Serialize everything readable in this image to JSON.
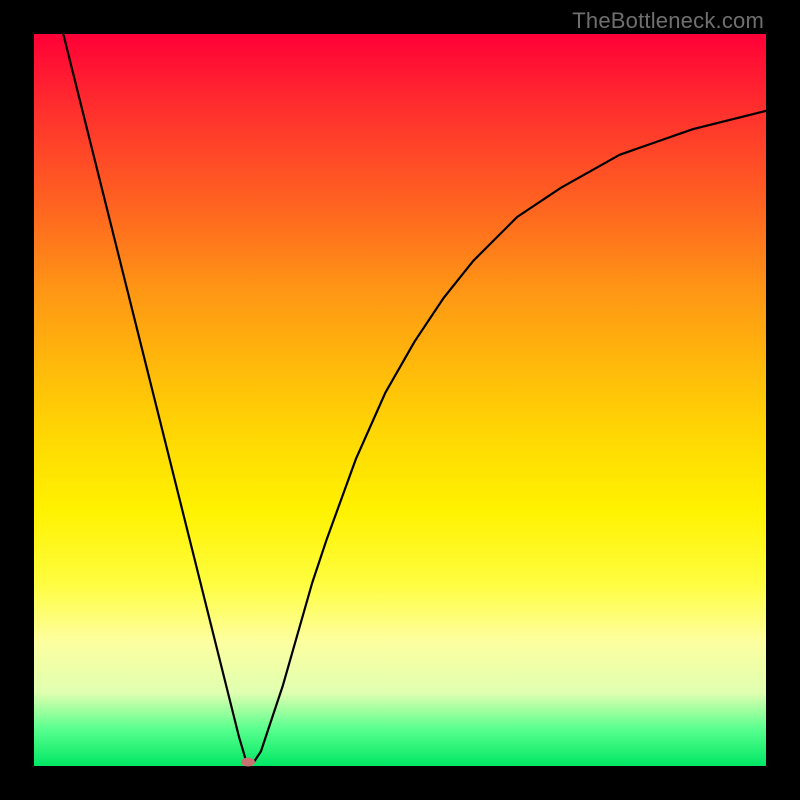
{
  "watermark": "TheBottleneck.com",
  "chart_data": {
    "type": "line",
    "title": "",
    "xlabel": "",
    "ylabel": "",
    "xlim": [
      0,
      100
    ],
    "ylim": [
      0,
      100
    ],
    "grid": false,
    "legend": false,
    "background_gradient": {
      "direction": "top-to-bottom",
      "stops": [
        {
          "pos": 0,
          "color": "#ff0037"
        },
        {
          "pos": 25,
          "color": "#ff6a1f"
        },
        {
          "pos": 50,
          "color": "#ffc807"
        },
        {
          "pos": 75,
          "color": "#fffd3f"
        },
        {
          "pos": 100,
          "color": "#00e763"
        }
      ]
    },
    "series": [
      {
        "name": "bottleneck-curve",
        "x": [
          4,
          6,
          8,
          10,
          12,
          14,
          16,
          18,
          20,
          22,
          24,
          26,
          28,
          29,
          30,
          31,
          32,
          34,
          36,
          38,
          40,
          44,
          48,
          52,
          56,
          60,
          66,
          72,
          80,
          90,
          100
        ],
        "y": [
          100,
          92,
          84,
          76,
          68,
          60,
          52,
          44,
          36,
          28,
          20,
          12,
          4,
          0.6,
          0.5,
          2,
          5,
          11,
          18,
          25,
          31,
          42,
          51,
          58,
          64,
          69,
          75,
          79,
          83.5,
          87,
          89.5
        ]
      }
    ],
    "annotations": [
      {
        "type": "point-marker",
        "name": "minimum",
        "x": 29.3,
        "y": 0.5,
        "color": "#c97371"
      }
    ]
  }
}
